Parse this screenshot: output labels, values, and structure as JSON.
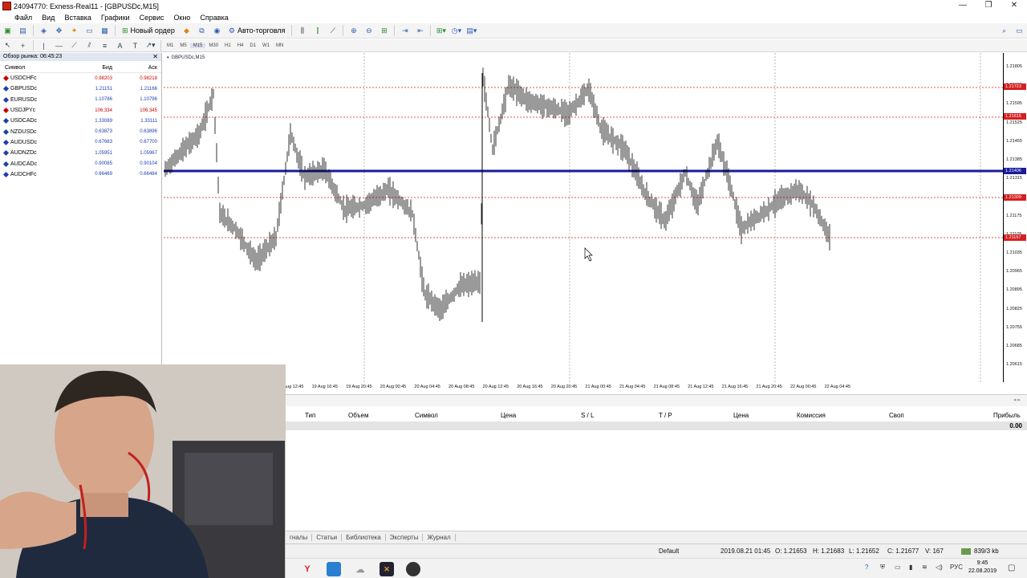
{
  "window": {
    "title": "24094770: Exness-Real11 - [GBPUSDc,M15]",
    "btn_min": "—",
    "btn_max": "❐",
    "btn_close": "✕"
  },
  "menu": [
    "Файл",
    "Вид",
    "Вставка",
    "Графики",
    "Сервис",
    "Окно",
    "Справка"
  ],
  "toolbar": {
    "new_order": "Новый ордер",
    "autotrading": "Авто-торговля"
  },
  "timeframes": [
    "M1",
    "M5",
    "M15",
    "M30",
    "H1",
    "H4",
    "D1",
    "W1",
    "MN"
  ],
  "market_watch": {
    "title": "Обзор рынка: 06:45:23",
    "close": "✕",
    "col_symbol": "Символ",
    "col_bid": "Бид",
    "col_ask": "Аск",
    "rows": [
      {
        "symbol": "USDCHFc",
        "bid": "0.98203",
        "ask": "0.98218",
        "color": "#c80000"
      },
      {
        "symbol": "GBPUSDc",
        "bid": "1.21151",
        "ask": "1.21166",
        "color": "#1c3fae"
      },
      {
        "symbol": "EURUSDc",
        "bid": "1.10786",
        "ask": "1.10796",
        "color": "#1c3fae"
      },
      {
        "symbol": "USDJPYc",
        "bid": "106.334",
        "ask": "106.345",
        "color": "#c80000"
      },
      {
        "symbol": "USDCADc",
        "bid": "1.33089",
        "ask": "1.33111",
        "color": "#1c3fae"
      },
      {
        "symbol": "NZDUSDc",
        "bid": "0.63873",
        "ask": "0.63896",
        "color": "#1c3fae"
      },
      {
        "symbol": "AUDUSDc",
        "bid": "0.67683",
        "ask": "0.67700",
        "color": "#1c3fae"
      },
      {
        "symbol": "AUDNZDc",
        "bid": "1.05951",
        "ask": "1.05967",
        "color": "#1c3fae"
      },
      {
        "symbol": "AUDCADc",
        "bid": "0.90085",
        "ask": "0.90104",
        "color": "#1c3fae"
      },
      {
        "symbol": "AUDCHFc",
        "bid": "0.66469",
        "ask": "0.66484",
        "color": "#1c3fae"
      }
    ]
  },
  "chart": {
    "symbol_label": "GBPUSDc,M15",
    "y_labels": [
      "1.21805",
      "1.21665",
      "1.21595",
      "1.21525",
      "1.21455",
      "1.21385",
      "1.21315",
      "1.21245",
      "1.21175",
      "1.21105",
      "1.21035",
      "1.20965",
      "1.20895",
      "1.20825",
      "1.20755",
      "1.20685",
      "1.20615"
    ],
    "price_tags": [
      {
        "text": "1.21723",
        "color": "#d42020"
      },
      {
        "text": "1.21615",
        "color": "#d42020"
      },
      {
        "text": "1.21406",
        "color": "#1a1a9c"
      },
      {
        "text": "1.21309",
        "color": "#d42020"
      },
      {
        "text": "1.21157",
        "color": "#d42020"
      }
    ],
    "x_labels": [
      "19 Aug 12:45",
      "19 Aug 16:45",
      "19 Aug 20:45",
      "20 Aug 00:45",
      "20 Aug 04:45",
      "20 Aug 08:45",
      "20 Aug 12:45",
      "20 Aug 16:45",
      "20 Aug 20:45",
      "21 Aug 00:45",
      "21 Aug 04:45",
      "21 Aug 08:45",
      "21 Aug 12:45",
      "21 Aug 16:45",
      "21 Aug 20:45",
      "22 Aug 00:45",
      "22 Aug 04:45"
    ]
  },
  "terminal": {
    "columns": [
      "Тип",
      "Объем",
      "Символ",
      "Цена",
      "S / L",
      "T / P",
      "Цена",
      "Комиссия",
      "Своп",
      "Прибыль"
    ],
    "total": "0.00",
    "tabs": [
      "гналы",
      "Статьи",
      "Библиотека",
      "Эксперты",
      "Журнал"
    ]
  },
  "statusbar": {
    "profile": "Default",
    "datetime": "2019.08.21 01:45",
    "open": "O: 1.21653",
    "high": "H: 1.21683",
    "low": "L: 1.21652",
    "close": "C: 1.21677",
    "volume": "V: 167",
    "traffic": "839/3 kb"
  },
  "taskbar": {
    "lang": "РУС",
    "time": "9:45",
    "date": "22.08.2019"
  }
}
